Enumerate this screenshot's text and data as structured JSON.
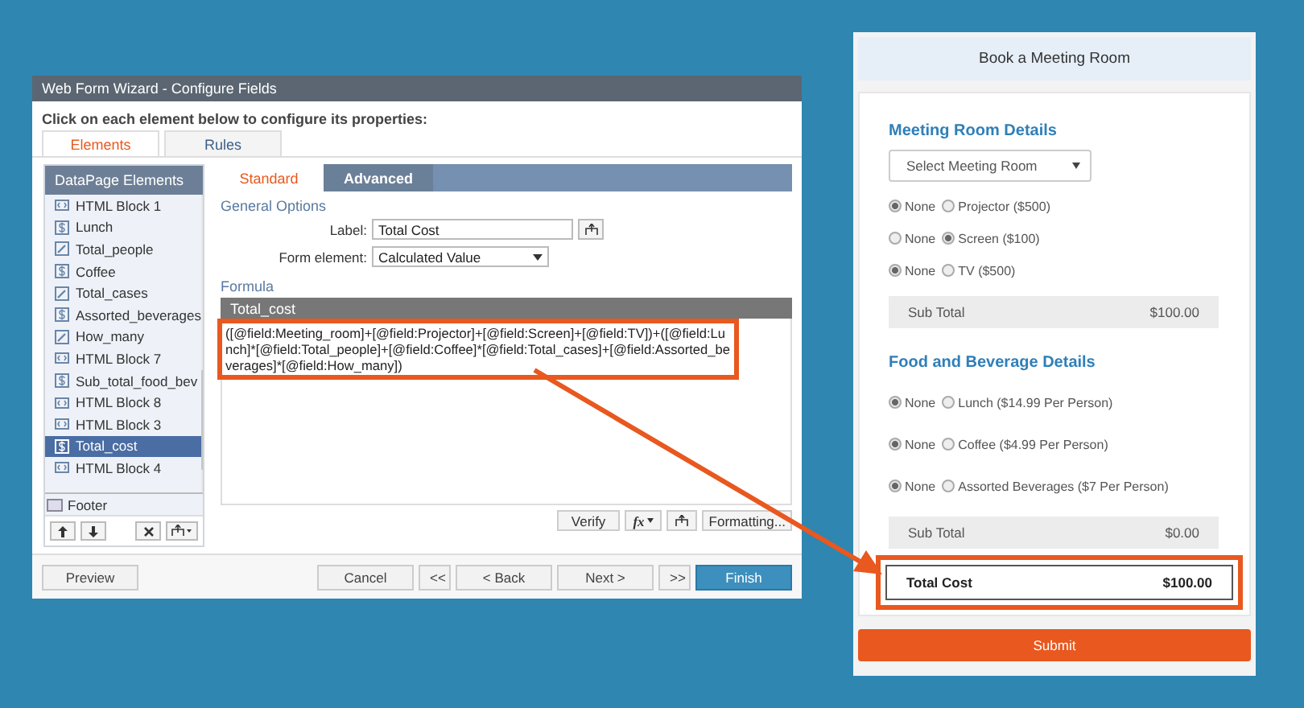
{
  "wizard": {
    "title": "Web Form Wizard - Configure Fields",
    "instruction": "Click on each element below to configure its properties:",
    "tabs": [
      {
        "label": "Elements",
        "selected": true
      },
      {
        "label": "Rules",
        "selected": false
      }
    ],
    "sidebar": {
      "title": "DataPage Elements",
      "items": [
        {
          "label": "HTML Block 1",
          "kind": "html",
          "selected": false
        },
        {
          "label": "Lunch",
          "kind": "calc",
          "selected": false
        },
        {
          "label": "Total_people",
          "kind": "text",
          "selected": false
        },
        {
          "label": "Coffee",
          "kind": "calc",
          "selected": false
        },
        {
          "label": "Total_cases",
          "kind": "text",
          "selected": false
        },
        {
          "label": "Assorted_beverages",
          "kind": "calc",
          "selected": false
        },
        {
          "label": "How_many",
          "kind": "text",
          "selected": false
        },
        {
          "label": "HTML Block 7",
          "kind": "html",
          "selected": false
        },
        {
          "label": "Sub_total_food_bev",
          "kind": "calc",
          "selected": false
        },
        {
          "label": "HTML Block 8",
          "kind": "html",
          "selected": false
        },
        {
          "label": "HTML Block 3",
          "kind": "html",
          "selected": false
        },
        {
          "label": "Total_cost",
          "kind": "calc",
          "selected": true
        },
        {
          "label": "HTML Block 4",
          "kind": "html",
          "selected": false
        }
      ],
      "footer": "Footer"
    },
    "panel_tabs": [
      {
        "label": "Standard",
        "selected": true
      },
      {
        "label": "Advanced",
        "selected": false
      }
    ],
    "general_options": {
      "title": "General Options",
      "label_caption": "Label:",
      "label_value": "Total Cost",
      "element_caption": "Form element:",
      "element_value": "Calculated Value"
    },
    "formula": {
      "title": "Formula",
      "header": "Total_cost",
      "text": "([@field:Meeting_room]+[@field:Projector]+[@field:Screen]+[@field:TV])+([@field:Lunch]*[@field:Total_people]+[@field:Coffee]*[@field:Total_cases]+[@field:Assorted_beverages]*[@field:How_many])"
    },
    "formula_buttons": {
      "verify": "Verify",
      "fx": "fx",
      "formatting": "Formatting..."
    },
    "footer_buttons": {
      "preview": "Preview",
      "nav": [
        {
          "label": "Cancel",
          "primary": false
        },
        {
          "label": "<<",
          "primary": false
        },
        {
          "label": "< Back",
          "primary": false
        },
        {
          "label": "Next >",
          "primary": false
        },
        {
          "label": ">>",
          "primary": false
        },
        {
          "label": "Finish",
          "primary": true
        }
      ]
    }
  },
  "form": {
    "title": "Book a Meeting Room",
    "sections": [
      {
        "title": "Meeting Room Details",
        "select": "Select Meeting Room",
        "rows": [
          [
            {
              "label": "None",
              "selected": true
            },
            {
              "label": "Projector ($500)",
              "selected": false
            }
          ],
          [
            {
              "label": "None",
              "selected": false
            },
            {
              "label": "Screen ($100)",
              "selected": true
            }
          ],
          [
            {
              "label": "None",
              "selected": true
            },
            {
              "label": "TV ($500)",
              "selected": false
            }
          ]
        ],
        "subtotal": {
          "label": "Sub Total",
          "value": "$100.00"
        }
      },
      {
        "title": "Food and Beverage Details",
        "rows": [
          [
            {
              "label": "None",
              "selected": true
            },
            {
              "label": "Lunch ($14.99 Per Person)",
              "selected": false
            }
          ],
          [
            {
              "label": "None",
              "selected": true
            },
            {
              "label": "Coffee ($4.99 Per Person)",
              "selected": false
            }
          ],
          [
            {
              "label": "None",
              "selected": true
            },
            {
              "label": "Assorted Beverages ($7 Per Person)",
              "selected": false
            }
          ]
        ],
        "subtotal": {
          "label": "Sub Total",
          "value": "$0.00"
        }
      }
    ],
    "total": {
      "label": "Total Cost",
      "value": "$100.00"
    },
    "submit": "Submit"
  }
}
